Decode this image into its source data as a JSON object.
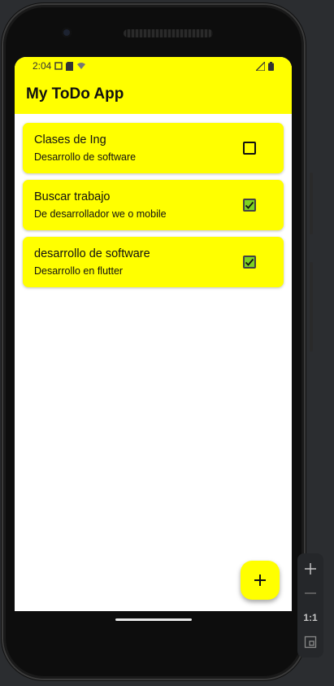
{
  "status_bar": {
    "time": "2:04"
  },
  "app_bar": {
    "title": "My ToDo App"
  },
  "todos": [
    {
      "title": "Clases de Ing",
      "subtitle": "Desarrollo de software",
      "done": false
    },
    {
      "title": "Buscar trabajo",
      "subtitle": "De desarrollador we o mobile",
      "done": true
    },
    {
      "title": "desarrollo de software",
      "subtitle": "Desarrollo en flutter",
      "done": true
    }
  ],
  "fab": {
    "icon": "plus-icon"
  },
  "emulator_toolbar": {
    "zoom_in_icon": "plus-icon",
    "zoom_out_icon": "minus-icon",
    "actual_size_label": "1:1",
    "fit_icon": "fit-screen-icon"
  },
  "colors": {
    "accent": "#ffff00",
    "checkbox_checked": "#7ed321",
    "frame": "#0d0d0d",
    "background": "#2b2d30"
  }
}
